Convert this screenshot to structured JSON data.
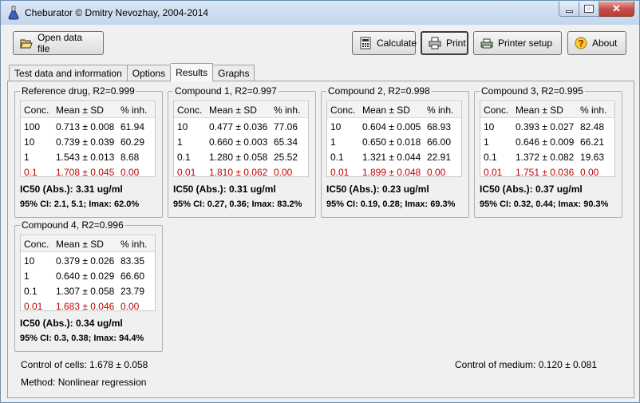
{
  "window": {
    "title": "Cheburator © Dmitry Nevozhay, 2004-2014",
    "icon": "flask-icon"
  },
  "toolbar": {
    "open_label": "Open data file",
    "calculate_label": "Calculate",
    "print_label": "Print",
    "printer_setup_label": "Printer setup",
    "about_label": "About"
  },
  "tabs": [
    {
      "label": "Test data and information"
    },
    {
      "label": "Options"
    },
    {
      "label": "Results"
    },
    {
      "label": "Graphs"
    }
  ],
  "table_headers": {
    "conc": "Conc.",
    "mean": "Mean ± SD",
    "inh": "% inh."
  },
  "compounds": [
    {
      "title": "Reference drug, R2=0.999",
      "rows": [
        {
          "conc": "100",
          "mean": "0.713 ± 0.008",
          "inh": "61.94"
        },
        {
          "conc": "10",
          "mean": "0.739 ± 0.039",
          "inh": "60.29"
        },
        {
          "conc": "1",
          "mean": "1.543 ± 0.013",
          "inh": "8.68"
        },
        {
          "conc": "0.1",
          "mean": "1.708 ± 0.045",
          "inh": "0.00"
        }
      ],
      "ic50": "IC50 (Abs.): 3.31 ug/ml",
      "ci": "95% CI:  2.1, 5.1; Imax: 62.0%"
    },
    {
      "title": "Compound 1, R2=0.997",
      "rows": [
        {
          "conc": "10",
          "mean": "0.477 ± 0.036",
          "inh": "77.06"
        },
        {
          "conc": "1",
          "mean": "0.660 ± 0.003",
          "inh": "65.34"
        },
        {
          "conc": "0.1",
          "mean": "1.280 ± 0.058",
          "inh": "25.52"
        },
        {
          "conc": "0.01",
          "mean": "1.810 ± 0.062",
          "inh": "0.00"
        }
      ],
      "ic50": "IC50 (Abs.): 0.31 ug/ml",
      "ci": "95% CI:  0.27, 0.36; Imax: 83.2%"
    },
    {
      "title": "Compound 2, R2=0.998",
      "rows": [
        {
          "conc": "10",
          "mean": "0.604 ± 0.005",
          "inh": "68.93"
        },
        {
          "conc": "1",
          "mean": "0.650 ± 0.018",
          "inh": "66.00"
        },
        {
          "conc": "0.1",
          "mean": "1.321 ± 0.044",
          "inh": "22.91"
        },
        {
          "conc": "0.01",
          "mean": "1.899 ± 0.048",
          "inh": "0.00"
        }
      ],
      "ic50": "IC50 (Abs.): 0.23 ug/ml",
      "ci": "95% CI:  0.19, 0.28; Imax: 69.3%"
    },
    {
      "title": "Compound 3, R2=0.995",
      "rows": [
        {
          "conc": "10",
          "mean": "0.393 ± 0.027",
          "inh": "82.48"
        },
        {
          "conc": "1",
          "mean": "0.646 ± 0.009",
          "inh": "66.21"
        },
        {
          "conc": "0.1",
          "mean": "1.372 ± 0.082",
          "inh": "19.63"
        },
        {
          "conc": "0.01",
          "mean": "1.751 ± 0.036",
          "inh": "0.00"
        }
      ],
      "ic50": "IC50 (Abs.): 0.37 ug/ml",
      "ci": "95% CI:  0.32, 0.44; Imax: 90.3%"
    },
    {
      "title": "Compound 4, R2=0.996",
      "rows": [
        {
          "conc": "10",
          "mean": "0.379 ± 0.026",
          "inh": "83.35"
        },
        {
          "conc": "1",
          "mean": "0.640 ± 0.029",
          "inh": "66.60"
        },
        {
          "conc": "0.1",
          "mean": "1.307 ± 0.058",
          "inh": "23.79"
        },
        {
          "conc": "0.01",
          "mean": "1.683 ± 0.046",
          "inh": "0.00"
        }
      ],
      "ic50": "IC50 (Abs.): 0.34 ug/ml",
      "ci": "95% CI:  0.3, 0.38; Imax: 94.4%"
    }
  ],
  "footer": {
    "control_cells": "Control of cells:  1.678 ± 0.058",
    "control_medium": "Control of medium:   0.120 ± 0.081",
    "method": "Method: Nonlinear regression"
  },
  "colors": {
    "highlight_row": "#c00000"
  }
}
